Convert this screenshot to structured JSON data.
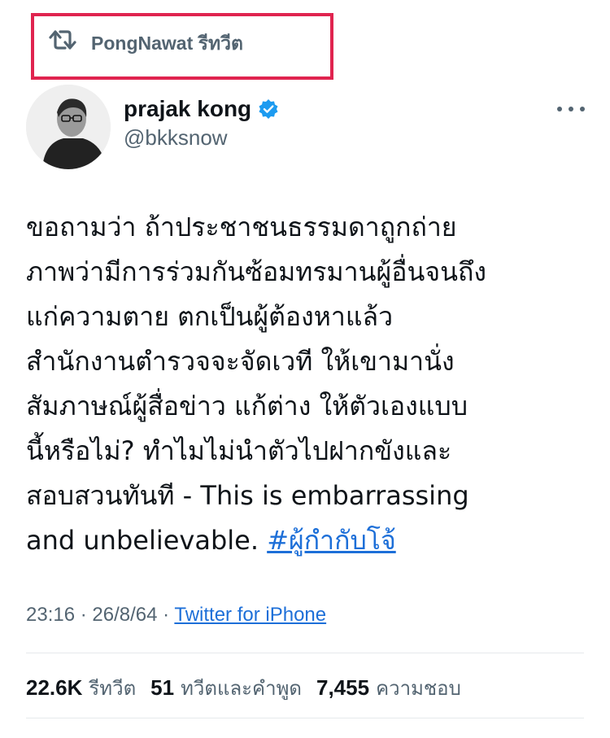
{
  "retweet": {
    "icon": "retweet-icon",
    "text": "PongNawat รีทวีต"
  },
  "author": {
    "display_name": "prajak kong",
    "handle": "@bkksnow",
    "verified_icon": "verified-badge-icon",
    "avatar": "avatar"
  },
  "tweet": {
    "lines": [
      "ขอถามว่า ถ้าประชาชนธรรมดาถูกถ่าย",
      "ภาพว่ามีการร่วมกันซ้อมทรมานผู้อื่นจนถึง",
      "แก่ความตาย ตกเป็นผู้ต้องหาแล้ว",
      "สำนักงานตำรวจจะจัดเวที ให้เขามานั่ง",
      "สัมภาษณ์ผู้สื่อข่าว แก้ต่าง ให้ตัวเองแบบ",
      "นี้หรือไม่?  ทำไมไม่นำตัวไปฝากขังและ",
      "สอบสวนทันที - This is embarrassing"
    ],
    "last_line_text": "and unbelievable. ",
    "hashtag": "#ผู้กำกับโจ้"
  },
  "meta": {
    "time": "23:16",
    "separator": " · ",
    "date": "26/8/64",
    "source": "Twitter for iPhone"
  },
  "stats": {
    "retweets_count": "22.6K",
    "retweets_label": "รีทวีต",
    "quotes_count": "51",
    "quotes_label": "ทวีตและคำพูด",
    "likes_count": "7,455",
    "likes_label": "ความชอบ"
  },
  "colors": {
    "highlight_border": "#e0244f",
    "link": "#1d6fd8",
    "verified": "#1d9bf0",
    "secondary_text": "#536471"
  }
}
